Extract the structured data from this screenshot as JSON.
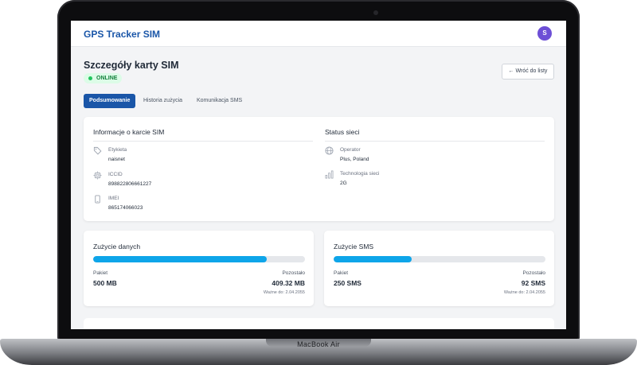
{
  "app": {
    "title": "GPS Tracker SIM",
    "avatar_initial": "S"
  },
  "page": {
    "title": "Szczegóły karty SIM",
    "status": "ONLINE",
    "back_label": "← Wróć do listy"
  },
  "tabs": [
    {
      "label": "Podsumowanie",
      "active": true
    },
    {
      "label": "Historia zużycia",
      "active": false
    },
    {
      "label": "Komunikacja SMS",
      "active": false
    }
  ],
  "sim_info": {
    "title": "Informacje o karcie SIM",
    "fields": [
      {
        "icon": "tag-icon",
        "label": "Etykieta",
        "value": "naisnet"
      },
      {
        "icon": "chip-icon",
        "label": "ICCID",
        "value": "898822806661227"
      },
      {
        "icon": "phone-icon",
        "label": "IMEI",
        "value": "865174066023"
      }
    ]
  },
  "network": {
    "title": "Status sieci",
    "fields": [
      {
        "icon": "globe-icon",
        "label": "Operator",
        "value": "Plus, Poland"
      },
      {
        "icon": "signal-bars-icon",
        "label": "Technologia sieci",
        "value": "2G"
      }
    ]
  },
  "data_usage": {
    "title": "Zużycie danych",
    "progress_fraction": 0.82,
    "package_label": "Pakiet",
    "package_value": "500 MB",
    "remaining_label": "Pozostało",
    "remaining_value": "409.32 MB",
    "valid_until": "Ważne do: 2.04.2055"
  },
  "sms_usage": {
    "title": "Zużycie SMS",
    "progress_fraction": 0.37,
    "package_label": "Pakiet",
    "package_value": "250 SMS",
    "remaining_label": "Pozostało",
    "remaining_value": "92 SMS",
    "valid_until": "Ważne do: 2.04.2055"
  },
  "device": {
    "brand": "MacBook Air"
  },
  "colors": {
    "primary": "#1a56a8",
    "progress": "#0ea5e9",
    "online": "#22c55e"
  }
}
